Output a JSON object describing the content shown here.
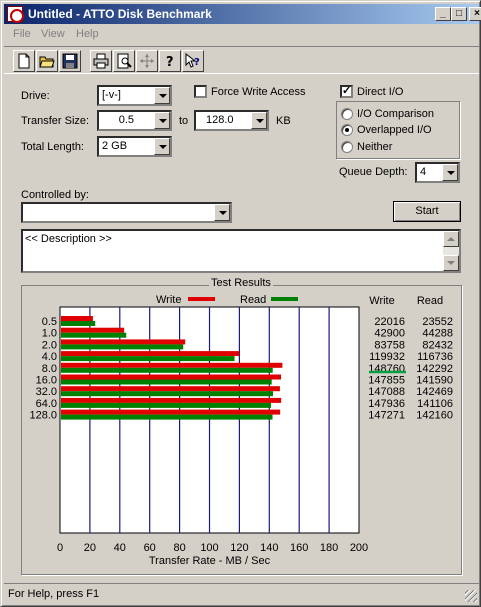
{
  "window": {
    "title": "Untitled - ATTO Disk Benchmark",
    "minimize_glyph": "_",
    "maximize_glyph": "□",
    "close_glyph": "×"
  },
  "menu": [
    "File",
    "View",
    "Help"
  ],
  "toolbar": {
    "icons": [
      "new-file-icon",
      "open-folder-icon",
      "save-icon",
      "print-icon",
      "print-preview-icon",
      "move-icon",
      "help-icon",
      "context-help-icon"
    ]
  },
  "settings": {
    "drive_label": "Drive:",
    "drive_value": "[-v-]",
    "transfer_size_label": "Transfer Size:",
    "transfer_from": "0.5",
    "to_label": "to",
    "transfer_to": "128.0",
    "kb_label": "KB",
    "total_length_label": "Total Length:",
    "total_length_value": "2 GB",
    "force_write_label": "Force Write Access",
    "force_write_checked": false,
    "direct_io_label": "Direct I/O",
    "direct_io_checked": true,
    "io_comparison_label": "I/O Comparison",
    "overlapped_io_label": "Overlapped I/O",
    "neither_label": "Neither",
    "selected_mode": "overlapped",
    "queue_depth_label": "Queue Depth:",
    "queue_depth_value": "4",
    "controlled_by_label": "Controlled by:",
    "controlled_by_value": "",
    "start_label": "Start",
    "description_text": "<< Description >>"
  },
  "results": {
    "group_title": "Test Results",
    "col_write": "Write",
    "col_read": "Read"
  },
  "status": {
    "text": "For Help, press F1"
  },
  "colors": {
    "write": "#e00000",
    "read": "#008000",
    "highlight": "#00a040"
  },
  "chart_data": {
    "type": "bar",
    "orientation": "horizontal",
    "categories": [
      "0.5",
      "1.0",
      "2.0",
      "4.0",
      "8.0",
      "16.0",
      "32.0",
      "64.0",
      "128.0"
    ],
    "series": [
      {
        "name": "Write",
        "values": [
          22016,
          42900,
          83758,
          119932,
          148760,
          147855,
          147088,
          147936,
          147271
        ]
      },
      {
        "name": "Read",
        "values": [
          23552,
          44288,
          82432,
          116736,
          142292,
          141590,
          142469,
          141106,
          142160
        ]
      }
    ],
    "write_text": [
      "22016",
      "42900",
      "83758",
      "119932",
      "148760",
      "147855",
      "147088",
      "147936",
      "147271"
    ],
    "read_text": [
      "23552",
      "44288",
      "82432",
      "116736",
      "142292",
      "141590",
      "142469",
      "141106",
      "142160"
    ],
    "value_unit_divisor": 1000,
    "xlabel": "Transfer Rate - MB / Sec",
    "xlim": [
      0,
      200
    ],
    "xticks": [
      "0",
      "20",
      "40",
      "60",
      "80",
      "100",
      "120",
      "140",
      "160",
      "180",
      "200"
    ],
    "legend": [
      {
        "name": "Write"
      },
      {
        "name": "Read"
      }
    ],
    "legend_position": "top",
    "grid": true
  }
}
